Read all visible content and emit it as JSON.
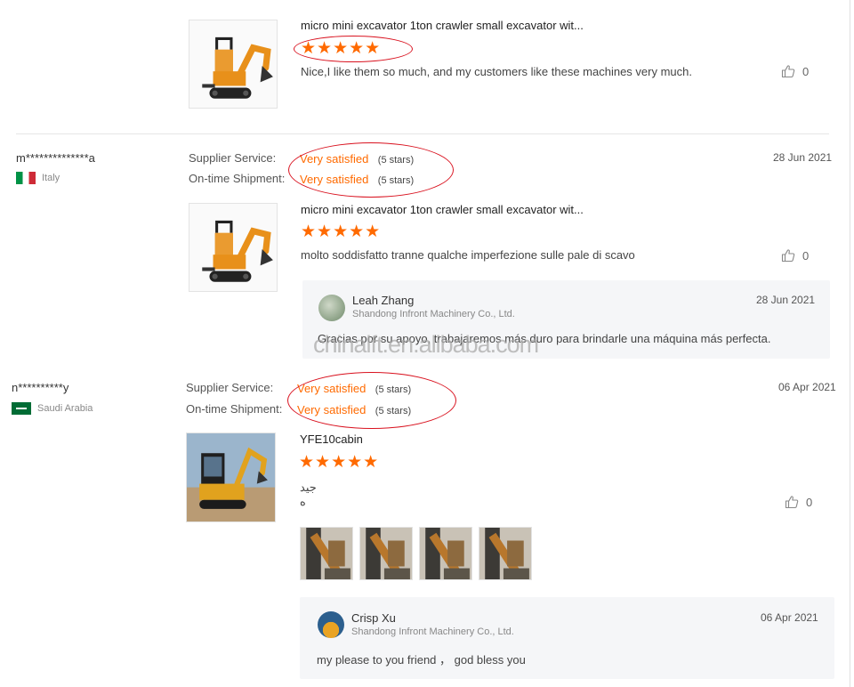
{
  "reviews": [
    {
      "product_title": "micro mini excavator 1ton crawler small excavator wit...",
      "stars": "★★★★★",
      "text": "Nice,I like them so much, and my customers like these machines very much.",
      "likes": "0"
    },
    {
      "user": "m**************a",
      "country": "Italy",
      "supplier_label": "Supplier Service:",
      "supplier_value": "Very satisfied",
      "supplier_stars": "(5 stars)",
      "shipment_label": "On-time Shipment:",
      "shipment_value": "Very satisfied",
      "shipment_stars": "(5 stars)",
      "date": "28 Jun 2021",
      "product_title": "micro mini excavator 1ton crawler small excavator wit...",
      "stars": "★★★★★",
      "text": "molto soddisfatto  tranne qualche imperfezione sulle pale di scavo",
      "likes": "0",
      "reply": {
        "name": "Leah Zhang",
        "company": "Shandong Infront Machinery Co., Ltd.",
        "date": "28 Jun 2021",
        "text": "Gracias por su apoyo, trabajaremos más duro para brindarle una máquina más perfecta."
      }
    },
    {
      "user": "n**********y",
      "country": "Saudi Arabia",
      "supplier_label": "Supplier Service:",
      "supplier_value": "Very satisfied",
      "supplier_stars": "(5 stars)",
      "shipment_label": "On-time Shipment:",
      "shipment_value": "Very satisfied",
      "shipment_stars": "(5 stars)",
      "date": "06 Apr 2021",
      "product_title": "YFE10cabin",
      "stars": "★★★★★",
      "text_line1": "جيد",
      "text_line2": "ه",
      "likes": "0",
      "reply": {
        "name": "Crisp Xu",
        "company": "Shandong Infront Machinery Co., Ltd.",
        "date": "06 Apr 2021",
        "text": "my please to you friend ，  god bless you"
      }
    }
  ],
  "watermark": "chinalft.en.alibaba.com",
  "colors": {
    "accent": "#ff6a00",
    "highlight_ellipse": "#d9121f"
  },
  "icons": {
    "like": "thumbs-up-icon"
  }
}
